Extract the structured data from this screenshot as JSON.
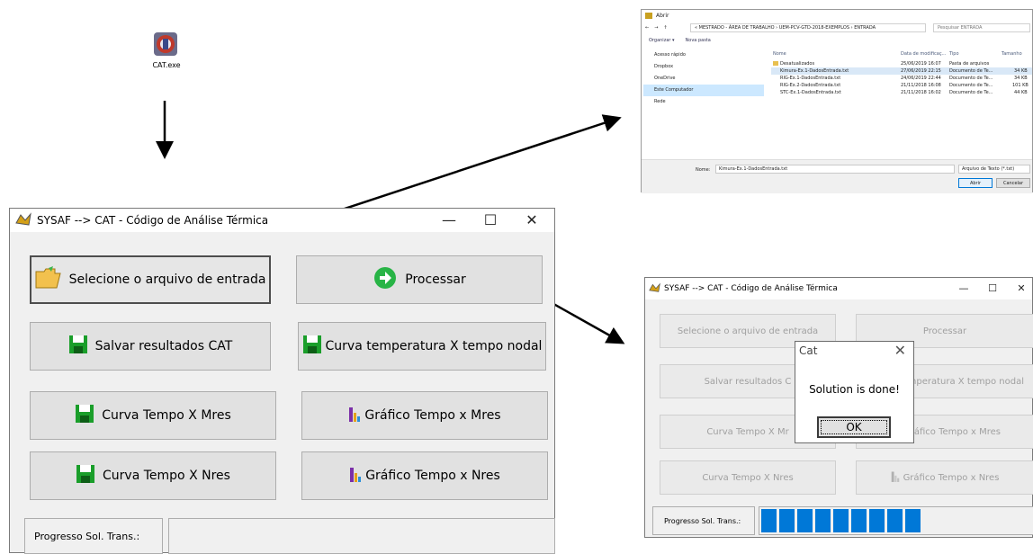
{
  "desktop": {
    "exe_label": "CAT.exe"
  },
  "colors": {
    "accent": "#0078d7",
    "floppy_green": "#1a9e2a",
    "process_green": "#28b446",
    "chart_purple": "#7b2fa8"
  },
  "main_window": {
    "title": "SYSAF --> CAT - Código de Análise Térmica",
    "controls": {
      "minimize": "—",
      "maximize": "☐",
      "close": "✕"
    },
    "buttons": {
      "select_input": "Selecione o arquivo de entrada",
      "process": "Processar",
      "save_results": "Salvar resultados CAT",
      "temp_curve": "Curva temperatura X tempo nodal",
      "curve_mres": "Curva Tempo X Mres",
      "chart_mres": "Gráfico Tempo x Mres",
      "curve_nres": "Curva Tempo X Nres",
      "chart_nres": "Gráfico Tempo x Nres"
    },
    "progress_label": "Progresso Sol. Trans.:"
  },
  "done_window": {
    "title": "SYSAF --> CAT - Código de Análise Térmica",
    "controls": {
      "minimize": "—",
      "maximize": "☐",
      "close": "✕"
    },
    "buttons": {
      "select_input": "Selecione o arquivo de entrada",
      "process": "Processar",
      "save_results": "Salvar resultados C",
      "temp_curve": "temperatura X tempo nodal",
      "curve_mres": "Curva Tempo X Mr",
      "chart_mres": "ráfico Tempo x Mres",
      "curve_nres": "Curva Tempo X Nres",
      "chart_nres": "Gráfico Tempo x Nres"
    },
    "progress_label": "Progresso Sol. Trans.:",
    "progress_fraction": 0.6,
    "dialog": {
      "title": "Cat",
      "close": "✕",
      "message": "Solution is done!",
      "ok": "OK"
    }
  },
  "file_dialog": {
    "title": "Abrir",
    "path": "« MESTRADO - ÁREA DE TRABALHO › UEM-PCV-GTD-2018-EXEMPLOS › ENTRADA",
    "search_placeholder": "Pesquisar ENTRADA",
    "toolbar": {
      "organize": "Organizar ▾",
      "new_folder": "Nova pasta"
    },
    "sidebar": [
      "Acesso rápido",
      "Dropbox",
      "OneDrive",
      "Este Computador",
      "Rede"
    ],
    "columns": {
      "name": "Nome",
      "date": "Data de modificaç...",
      "type": "Tipo",
      "size": "Tamanho"
    },
    "files": [
      {
        "name": "Desatualizados",
        "date": "25/06/2019 16:07",
        "type": "Pasta de arquivos",
        "size": ""
      },
      {
        "name": "Kimura-Ex.1-DadosEntrada.txt",
        "date": "27/06/2019 22:15",
        "type": "Documento de Te...",
        "size": "34 KB"
      },
      {
        "name": "RIG-Ex.1-DadosEntrada.txt",
        "date": "24/06/2019 22:44",
        "type": "Documento de Te...",
        "size": "34 KB"
      },
      {
        "name": "RIG-Ex.2-DadosEntrada.txt",
        "date": "21/11/2018 16:08",
        "type": "Documento de Te...",
        "size": "101 KB"
      },
      {
        "name": "STC-Ex.1-DadosEntrada.txt",
        "date": "21/11/2018 16:02",
        "type": "Documento de Te...",
        "size": "44 KB"
      }
    ],
    "filename_label": "Nome:",
    "filename_value": "Kimura-Ex.1-DadosEntrada.txt",
    "filetype": "Arquivo de Texto (*.txt)",
    "open_label": "Abrir",
    "cancel_label": "Cancelar"
  }
}
